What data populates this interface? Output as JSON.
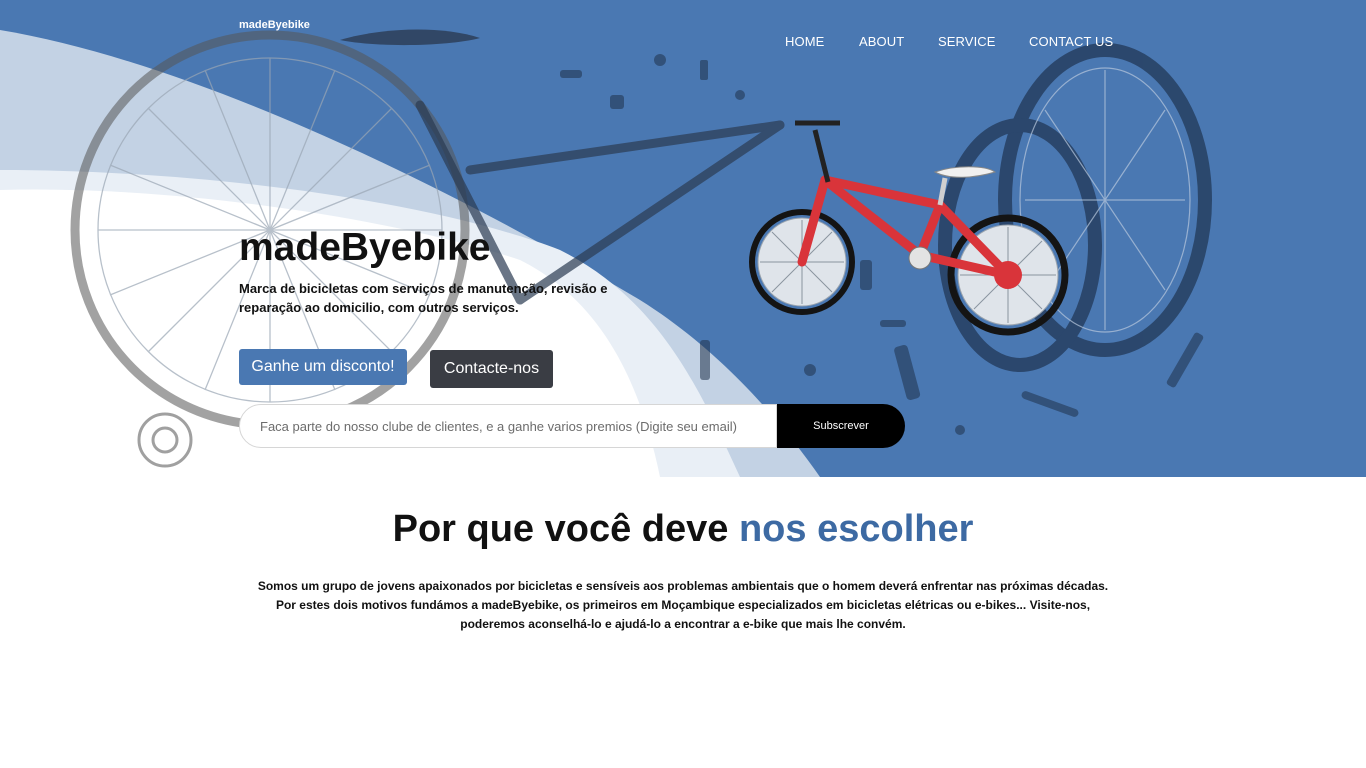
{
  "header": {
    "brand": "madeByebike",
    "nav": [
      "HOME",
      "ABOUT",
      "SERVICE",
      "CONTACT US"
    ]
  },
  "hero": {
    "title": "madeByebike",
    "subtitle": "Marca de bicicletas com serviços de manutenção, revisão e reparação ao domicilio, com outros serviços.",
    "discount_button": "Ganhe um disconto!",
    "contact_button": "Contacte-nos",
    "subscribe": {
      "placeholder": "Faca parte do nosso clube de clientes, e a ganhe varios premios (Digite seu email)",
      "button": "Subscrever"
    }
  },
  "why": {
    "title_main": "Por que você deve ",
    "title_accent": "nos escolher",
    "lines": [
      "Somos um grupo de jovens apaixonados por bicicletas e sensíveis aos problemas ambientais que o homem deverá enfrentar nas próximas décadas.",
      "Por estes dois motivos fundámos a madeByebike, os primeiros em Moçambique especializados em bicicletas elétricas ou e-bikes... Visite-nos,",
      "poderemos aconselhá-lo e ajudá-lo a encontrar a e-bike que mais lhe convém."
    ]
  },
  "colors": {
    "hero_blue": "#4a78b2",
    "accent": "#3d6aa3",
    "dark_button": "#3a3d44",
    "bike_red": "#d9343a"
  },
  "icons": [
    "exploded-bike-illustration",
    "red-bmx-bike-image"
  ]
}
